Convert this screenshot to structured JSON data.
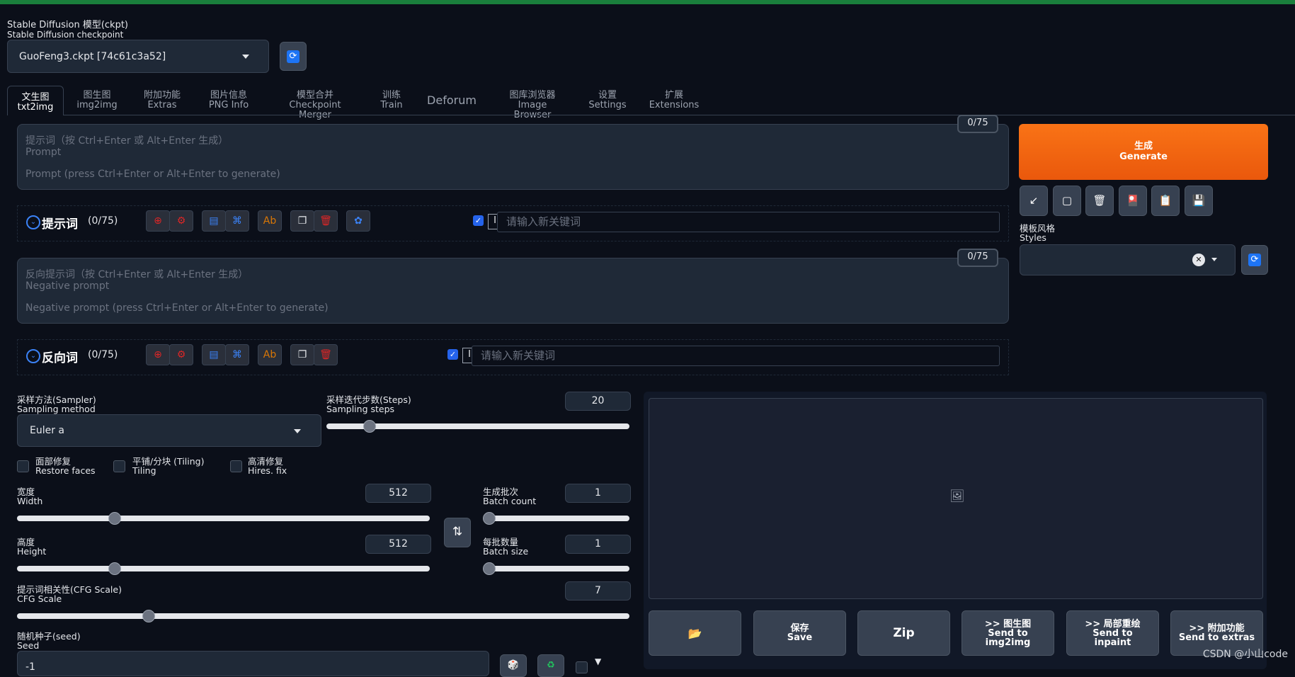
{
  "checkpoint": {
    "label_cn": "Stable Diffusion 模型(ckpt)",
    "label_en": "Stable Diffusion checkpoint",
    "value": "GuoFeng3.ckpt [74c61c3a52]"
  },
  "tabs": [
    {
      "cn": "文生图",
      "en": "txt2img",
      "active": true
    },
    {
      "cn": "图生图",
      "en": "img2img"
    },
    {
      "cn": "附加功能",
      "en": "Extras"
    },
    {
      "cn": "图片信息",
      "en": "PNG Info"
    },
    {
      "cn": "模型合并",
      "en": "Checkpoint Merger"
    },
    {
      "cn": "训练",
      "en": "Train"
    },
    {
      "cn": "Deforum",
      "en": ""
    },
    {
      "cn": "图库浏览器",
      "en": "Image Browser"
    },
    {
      "cn": "设置",
      "en": "Settings"
    },
    {
      "cn": "扩展",
      "en": "Extensions"
    }
  ],
  "prompt": {
    "counter": "0/75",
    "label_cn": "提示词（按 Ctrl+Enter 或 Alt+Enter 生成）",
    "label_en": "Prompt",
    "placeholder": "Prompt (press Ctrl+Enter or Alt+Enter to generate)"
  },
  "prompt_keywords": {
    "title": "提示词",
    "count": "(0/75)",
    "input_placeholder": "请输入新关键词"
  },
  "negative": {
    "counter": "0/75",
    "label_cn": "反向提示词（按 Ctrl+Enter 或 Alt+Enter 生成）",
    "label_en": "Negative prompt",
    "placeholder": "Negative prompt (press Ctrl+Enter or Alt+Enter to generate)"
  },
  "negative_keywords": {
    "title": "反向词",
    "count": "(0/75)",
    "input_placeholder": "请输入新关键词"
  },
  "generate": {
    "cn": "生成",
    "en": "Generate"
  },
  "styles": {
    "label_cn": "模板风格",
    "label_en": "Styles"
  },
  "sampler": {
    "label_cn": "采样方法(Sampler)",
    "label_en": "Sampling method",
    "value": "Euler a"
  },
  "steps": {
    "label_cn": "采样迭代步数(Steps)",
    "label_en": "Sampling steps",
    "value": "20",
    "fraction": 0.14
  },
  "options": {
    "restore_faces": {
      "cn": "面部修复",
      "en": "Restore faces"
    },
    "tiling": {
      "cn": "平铺/分块 (Tiling)",
      "en": "Tiling"
    },
    "hires": {
      "cn": "高清修复",
      "en": "Hires. fix"
    }
  },
  "width": {
    "cn": "宽度",
    "en": "Width",
    "value": "512",
    "fraction": 0.235
  },
  "height": {
    "cn": "高度",
    "en": "Height",
    "value": "512",
    "fraction": 0.235
  },
  "batch_count": {
    "cn": "生成批次",
    "en": "Batch count",
    "value": "1",
    "fraction": 0.0
  },
  "batch_size": {
    "cn": "每批数量",
    "en": "Batch size",
    "value": "1",
    "fraction": 0.0
  },
  "cfg": {
    "cn": "提示词相关性(CFG Scale)",
    "en": "CFG Scale",
    "value": "7",
    "fraction": 0.214
  },
  "seed": {
    "cn": "随机种子(seed)",
    "en": "Seed",
    "value": "-1"
  },
  "output_buttons": {
    "save": {
      "cn": "保存",
      "en": "Save"
    },
    "zip": "Zip",
    "img2img": {
      "cn": ">> 图生图",
      "en1": "Send to",
      "en2": "img2img"
    },
    "inpaint": {
      "cn": ">> 局部重绘",
      "en1": "Send to",
      "en2": "inpaint"
    },
    "extras": {
      "cn": ">> 附加功能",
      "en1": "Send to extras"
    }
  },
  "watermark": "CSDN @小山code",
  "colors": {
    "accent": "#ea580c",
    "background": "#0b0f19",
    "panel": "#1f2937",
    "checkbox": "#2563eb"
  }
}
